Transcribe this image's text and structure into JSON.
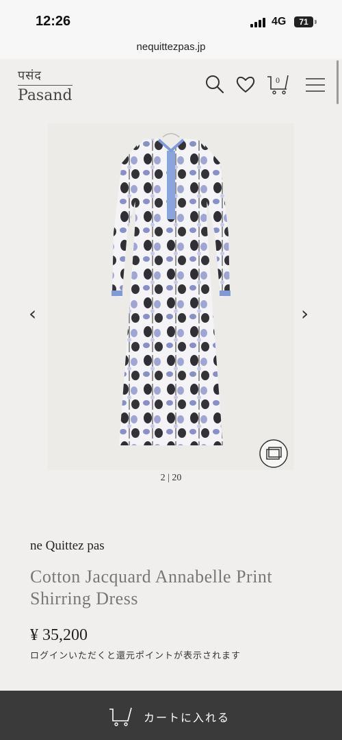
{
  "status_bar": {
    "time": "12:26",
    "network": "4G",
    "battery": "71"
  },
  "browser": {
    "url": "nequittezpas.jp"
  },
  "header": {
    "logo_devanagari": "पसंद",
    "logo_latin": "Pasand",
    "cart_count": "0",
    "icons": [
      "search-icon",
      "heart-icon",
      "cart-icon",
      "menu-icon"
    ]
  },
  "gallery": {
    "pager": "2 | 20",
    "prev_arrow": "‹",
    "next_arrow": "›"
  },
  "product": {
    "brand": "ne Quittez pas",
    "title": "Cotton Jacquard Annabelle Print Shirring Dress",
    "price": "¥ 35,200",
    "points_note": "ログインいただくと還元ポイントが表示されます"
  },
  "cart_bar": {
    "label": "カートに入れる"
  }
}
